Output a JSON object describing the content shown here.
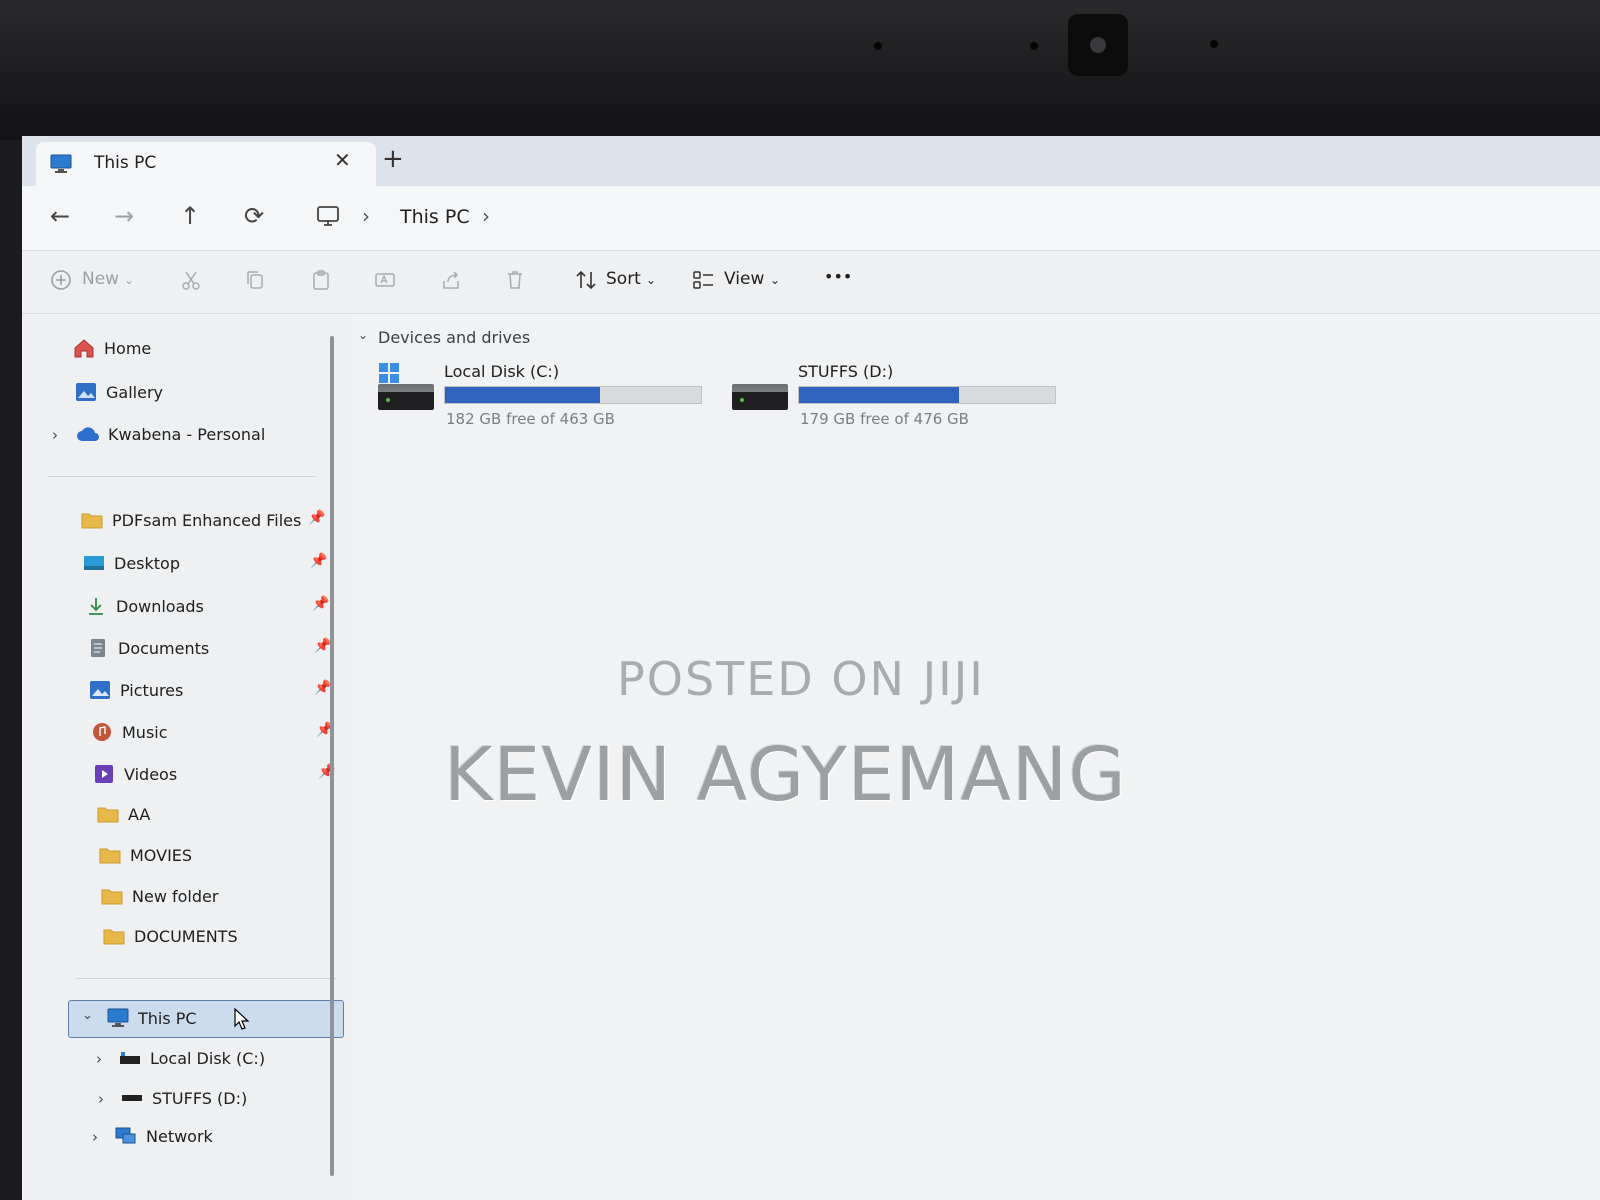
{
  "tab": {
    "title": "This PC",
    "close": "✕",
    "new": "+"
  },
  "nav": {
    "back": "←",
    "forward": "→",
    "up": "↑",
    "refresh": "⟳",
    "breadcrumb": [
      "This PC"
    ]
  },
  "toolbar": {
    "new_label": "New",
    "sort_label": "Sort",
    "view_label": "View",
    "more": "•••"
  },
  "sidebar": {
    "top": [
      {
        "label": "Home",
        "icon": "home-icon"
      },
      {
        "label": "Gallery",
        "icon": "gallery-icon"
      },
      {
        "label": "Kwabena - Personal",
        "icon": "cloud-icon"
      }
    ],
    "pinned": [
      {
        "label": "PDFsam Enhanced Files",
        "icon": "folder-icon"
      },
      {
        "label": "Desktop",
        "icon": "desktop-icon"
      },
      {
        "label": "Downloads",
        "icon": "download-icon"
      },
      {
        "label": "Documents",
        "icon": "documents-icon"
      },
      {
        "label": "Pictures",
        "icon": "pictures-icon"
      },
      {
        "label": "Music",
        "icon": "music-icon"
      },
      {
        "label": "Videos",
        "icon": "videos-icon"
      }
    ],
    "folders": [
      {
        "label": "AA"
      },
      {
        "label": "MOVIES"
      },
      {
        "label": "New folder"
      },
      {
        "label": "DOCUMENTS"
      }
    ],
    "tree": {
      "this_pc": "This PC",
      "children": [
        {
          "label": "Local Disk (C:)"
        },
        {
          "label": "STUFFS (D:)"
        }
      ],
      "network": "Network"
    },
    "pin_glyph": "📌"
  },
  "content": {
    "group_label": "Devices and drives",
    "drives": [
      {
        "name": "Local Disk (C:)",
        "free_text": "182 GB free of 463 GB",
        "used_fraction": 0.607
      },
      {
        "name": "STUFFS (D:)",
        "free_text": "179 GB free of 476 GB",
        "used_fraction": 0.624
      }
    ]
  },
  "watermark": {
    "line1": "POSTED ON JIJI",
    "line2": "KEVIN AGYEMANG"
  },
  "colors": {
    "accent": "#2f63be",
    "selection": "#ccdcef"
  }
}
